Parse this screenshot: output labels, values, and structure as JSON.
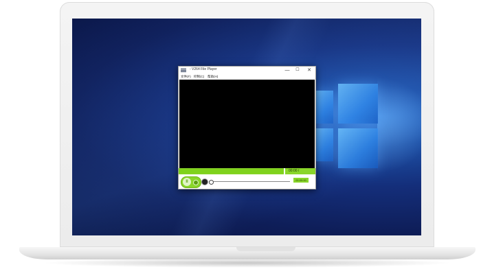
{
  "player": {
    "title": "- V264 File Player",
    "window_buttons": {
      "minimize": "—",
      "maximize": "☐",
      "close": "✕"
    },
    "menu": [
      "文件(F)",
      "控制(C)",
      "帮助(H)"
    ],
    "progress": {
      "played_fraction": 0.77,
      "time_text": "00:00  /"
    },
    "speed_text": "00:00:00",
    "play_pause_symbol": "II",
    "volume_fraction": 0.0
  },
  "colors": {
    "accent": "#8ad62a",
    "screen_bg": "#142e7a",
    "logo": "#2f86e8"
  },
  "icons": [
    "app-icon",
    "pause-icon",
    "stop-icon",
    "volume-icon",
    "windows-logo-icon"
  ]
}
